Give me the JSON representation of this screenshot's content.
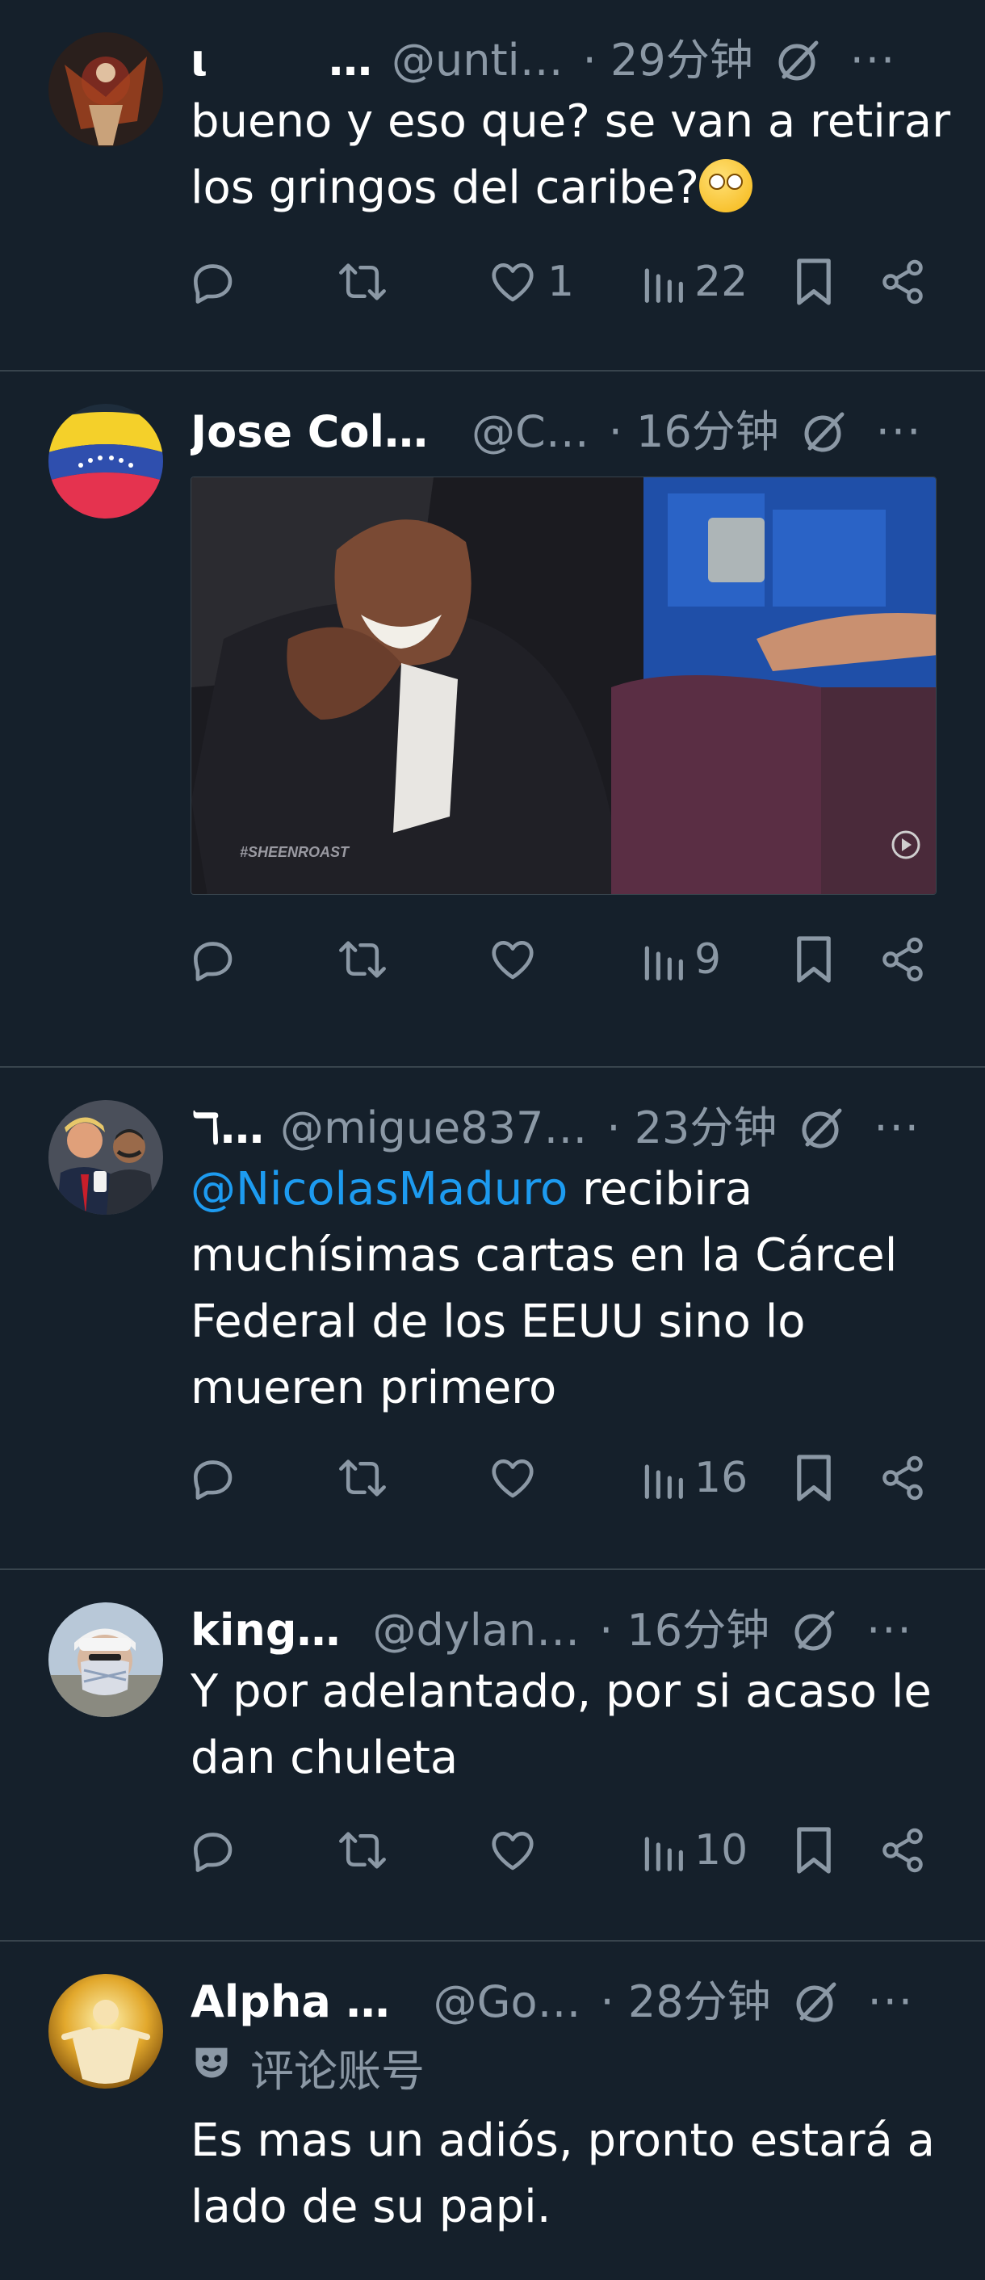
{
  "tweets": [
    {
      "name": "ι",
      "name_suffix": "…",
      "handle": "@unti…",
      "time": "· 29分钟",
      "text": "bueno y eso que? se van a retirar los gringos del caribe?",
      "has_emoji": true,
      "likes": "1",
      "views": "22"
    },
    {
      "name": "Jose Col…",
      "handle": "@C…",
      "time": "· 16分钟",
      "media_watermark": "#SHEENROAST",
      "likes": "",
      "views": "9"
    },
    {
      "name": "ℸ…",
      "handle": "@migue837…",
      "time": "· 23分钟",
      "mention": "@NicolasMaduro",
      "text": " recibira muchísimas cartas en la Cárcel Federal de los EEUU sino lo mueren primero",
      "likes": "",
      "views": "16"
    },
    {
      "name": "king…",
      "handle": "@dylan…",
      "time": "· 16分钟",
      "text": "Y por adelantado, por si acaso le dan chuleta",
      "likes": "",
      "views": "10"
    },
    {
      "name": "Alpha …",
      "handle": "@Go…",
      "time": "· 28分钟",
      "community_label": "评论账号",
      "text": "Es mas un adiós, pronto estará a lado de su papi."
    }
  ],
  "more_label": "···",
  "icons": {
    "reply": "reply-icon",
    "repost": "repost-icon",
    "like": "like-icon",
    "views": "views-icon",
    "bookmark": "bookmark-icon",
    "share": "share-icon",
    "grok": "grok-icon",
    "community": "mask-icon"
  },
  "colors": {
    "background": "#15202b",
    "divider": "#38444d",
    "secondary_text": "#8b98a5",
    "link": "#1d9bf0"
  }
}
